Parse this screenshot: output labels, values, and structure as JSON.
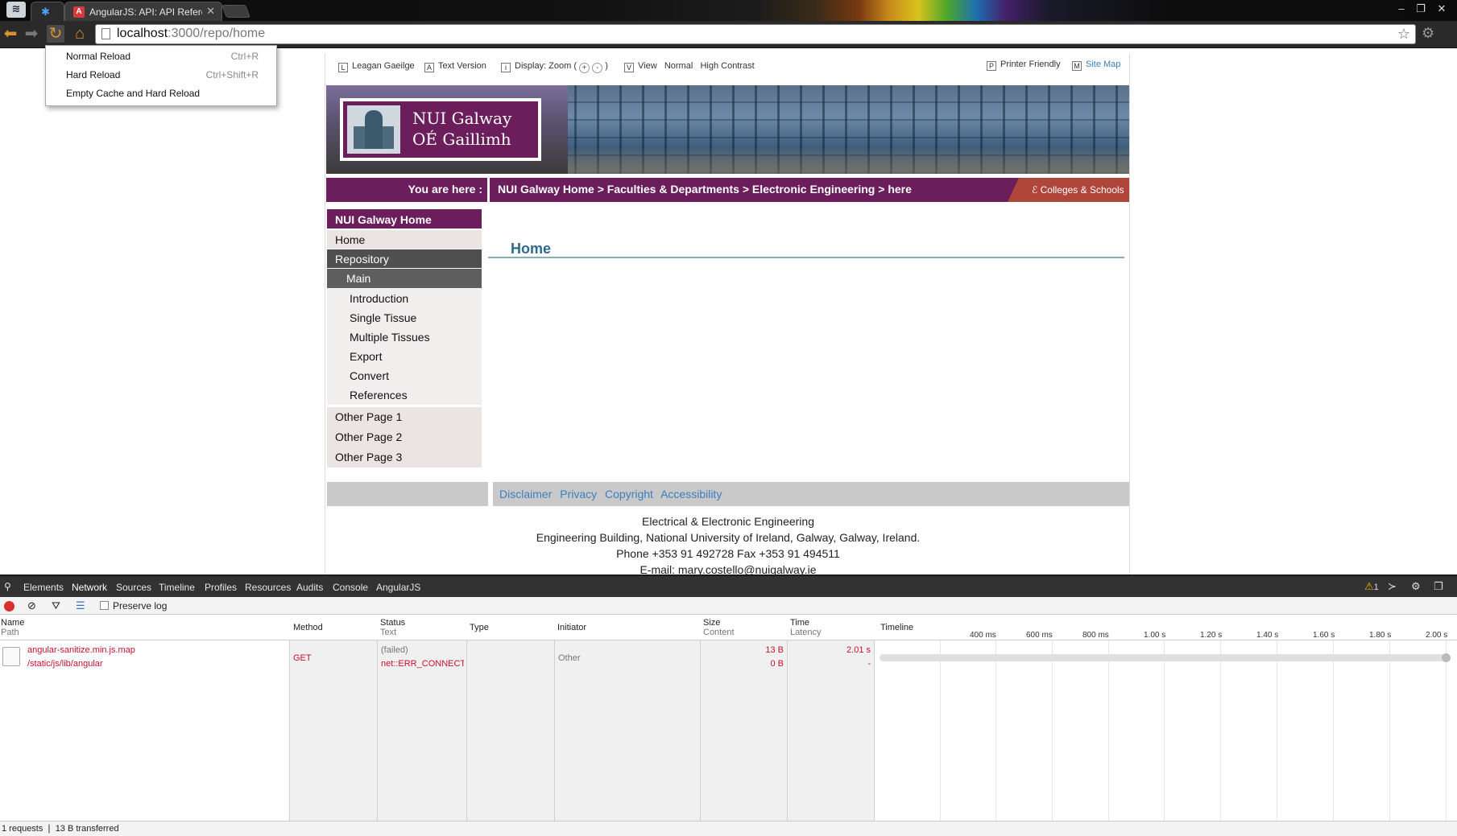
{
  "browser": {
    "tab_title": "AngularJS: API: API Refere",
    "url_host": "localhost",
    "url_rest": ":3000/repo/home",
    "reload_menu": [
      {
        "label": "Normal Reload",
        "shortcut": "Ctrl+R"
      },
      {
        "label": "Hard Reload",
        "shortcut": "Ctrl+Shift+R"
      },
      {
        "label": "Empty Cache and Hard Reload",
        "shortcut": ""
      }
    ]
  },
  "access_bar": {
    "gaeilge": {
      "key": "L",
      "label": "Leagan Gaeilge"
    },
    "text_version": {
      "key": "A",
      "label": "Text Version"
    },
    "display": {
      "key": "i",
      "label": "Display: Zoom (",
      "plus": "+",
      "minus": "-",
      "close": ")"
    },
    "view": {
      "key": "V",
      "label": "View",
      "normal": "Normal",
      "contrast": "High Contrast"
    },
    "printer": {
      "key": "P",
      "label": "Printer Friendly"
    },
    "sitemap": {
      "key": "M",
      "label": "Site Map"
    }
  },
  "logo": {
    "line1": "NUI Galway",
    "line2": "OÉ Gaillimh"
  },
  "breadcrumb": {
    "label": "You are here :",
    "trail": "NUI Galway Home > Faculties & Departments > Electronic Engineering > here",
    "colleges": "Colleges & Schools"
  },
  "sidenav": {
    "head": "NUI Galway Home",
    "home": "Home",
    "repository": "Repository",
    "main": "Main",
    "subs": [
      "Introduction",
      "Single Tissue",
      "Multiple Tissues",
      "Export",
      "Convert",
      "References"
    ],
    "others": [
      "Other Page 1",
      "Other Page 2",
      "Other Page 3"
    ]
  },
  "main": {
    "title": "Home"
  },
  "footer": {
    "links": [
      "Disclaimer",
      "Privacy",
      "Copyright",
      "Accessibility"
    ],
    "dept": "Electrical & Electronic Engineering",
    "address": "Engineering Building, National University of Ireland, Galway, Galway, Ireland.",
    "phone": "Phone +353 91 492728 Fax +353 91 494511",
    "email_label": "E-mail: ",
    "email": "mary.costello@nuigalway.ie"
  },
  "devtools": {
    "tabs": [
      "Elements",
      "Network",
      "Sources",
      "Timeline",
      "Profiles",
      "Resources",
      "Audits",
      "Console",
      "AngularJS"
    ],
    "warning_count": "1",
    "preserve_log": "Preserve log",
    "headers": {
      "name": "Name",
      "path": "Path",
      "method": "Method",
      "status": "Status",
      "text": "Text",
      "type": "Type",
      "initiator": "Initiator",
      "size": "Size",
      "content": "Content",
      "time": "Time",
      "latency": "Latency",
      "timeline": "Timeline"
    },
    "ticks": [
      "400 ms",
      "600 ms",
      "800 ms",
      "1.00 s",
      "1.20 s",
      "1.40 s",
      "1.60 s",
      "1.80 s",
      "2.00 s"
    ],
    "row": {
      "name": "angular-sanitize.min.js.map",
      "path": "/static/js/lib/angular",
      "method": "GET",
      "status": "(failed)",
      "status_text": "net::ERR_CONNECTI",
      "initiator": "Other",
      "size": "13 B",
      "content": "0 B",
      "time": "2.01 s",
      "latency": "-"
    },
    "status_bar": "1 requests  ❘  13 B transferred"
  }
}
